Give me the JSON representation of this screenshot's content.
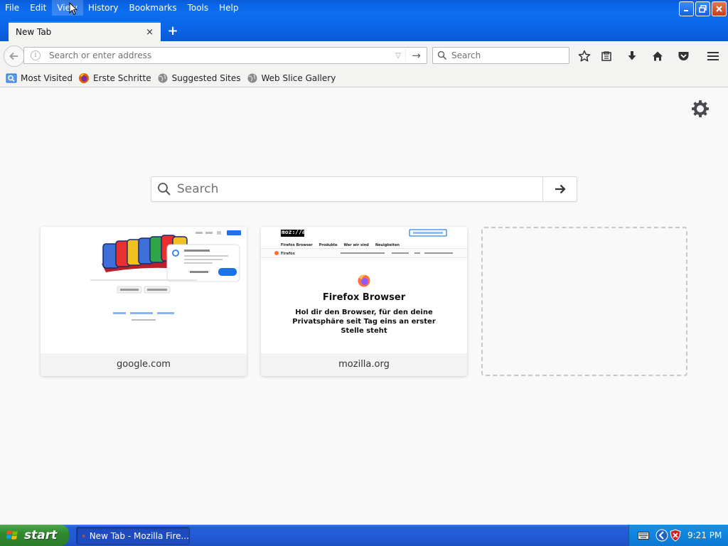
{
  "menu": {
    "items": [
      "File",
      "Edit",
      "View",
      "History",
      "Bookmarks",
      "Tools",
      "Help"
    ]
  },
  "tab": {
    "title": "New Tab",
    "close": "×",
    "new_tab": "+"
  },
  "navbar": {
    "url_placeholder": "Search or enter address",
    "search_placeholder": "Search"
  },
  "bookmarks": [
    "Most Visited",
    "Erste Schritte",
    "Suggested Sites",
    "Web Slice Gallery"
  ],
  "page": {
    "search_placeholder": "Search",
    "tiles": [
      {
        "label": "google.com"
      },
      {
        "label": "mozilla.org",
        "thumb": {
          "logo": "moz://a",
          "nav": [
            "Firefox Browser",
            "Produkte",
            "Wer wir sind",
            "Neuigkeiten"
          ],
          "subnav": "Firefox",
          "heading": "Firefox Browser",
          "tagline": "Hol dir den Browser, für den deine Privatsphäre seit Tag eins an erster Stelle steht"
        }
      }
    ]
  },
  "taskbar": {
    "start": "start",
    "task": "New Tab - Mozilla Fire...",
    "time": "9:21 PM"
  },
  "colors": {
    "accent": "#0a84ff",
    "titlebar": "#0b64e6",
    "taskbar": "#225ad6",
    "start": "#2f8a2f"
  }
}
